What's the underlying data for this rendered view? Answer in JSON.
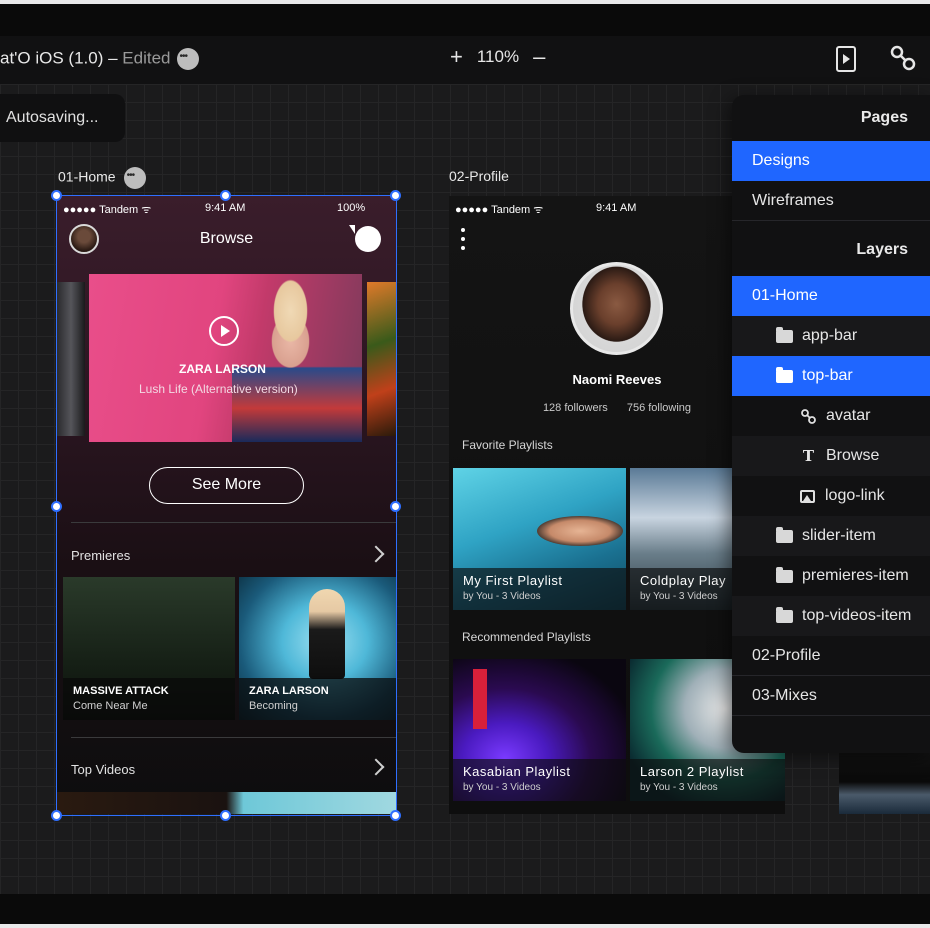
{
  "titlebar": {
    "doc_title": "at'O iOS (1.0) – ",
    "edited": "Edited",
    "zoom": "110%",
    "zoom_in": "+",
    "zoom_out": "–"
  },
  "autosave": "Autosaving...",
  "artboards": {
    "home_label": "01-Home",
    "profile_label": "02-Profile"
  },
  "home": {
    "status": {
      "carrier": "●●●●● Tandem ᯤ",
      "time": "9:41 AM",
      "battery": "100%"
    },
    "title": "Browse",
    "slide": {
      "artist": "ZARA LARSON",
      "song": "Lush Life (Alternative version)"
    },
    "see_more": "See More",
    "premieres_label": "Premieres",
    "tiles": [
      {
        "title": "MASSIVE ATTACK",
        "subtitle": "Come Near Me"
      },
      {
        "title": "ZARA LARSON",
        "subtitle": "Becoming"
      }
    ],
    "top_videos_label": "Top Videos"
  },
  "profile": {
    "status": {
      "carrier": "●●●●● Tandem ᯤ",
      "time": "9:41 AM"
    },
    "name": "Naomi Reeves",
    "followers": "128 followers",
    "following": "756 following",
    "favorite_label": "Favorite Playlists",
    "favorites": [
      {
        "title": "My First Playlist",
        "subtitle": "by You - 3 Videos"
      },
      {
        "title": "Coldplay Play",
        "subtitle": "by You - 3 Videos"
      }
    ],
    "recommended_label": "Recommended Playlists",
    "recommended": [
      {
        "title": "Kasabian Playlist",
        "subtitle": "by You - 3 Videos"
      },
      {
        "title": "Larson 2 Playlist",
        "subtitle": "by You - 3 Videos"
      }
    ]
  },
  "panel": {
    "pages_header": "Pages",
    "pages": [
      "Designs",
      "Wireframes"
    ],
    "layers_header": "Layers",
    "layers": [
      {
        "label": "01-Home",
        "icon": "none"
      },
      {
        "label": "app-bar",
        "icon": "folder-icon"
      },
      {
        "label": "top-bar",
        "icon": "folder-icon"
      },
      {
        "label": "avatar",
        "icon": "link-icon"
      },
      {
        "label": "Browse",
        "icon": "text-icon"
      },
      {
        "label": "logo-link",
        "icon": "image-icon"
      },
      {
        "label": "slider-item",
        "icon": "folder-icon"
      },
      {
        "label": "premieres-item",
        "icon": "folder-icon"
      },
      {
        "label": "top-videos-item",
        "icon": "folder-icon"
      },
      {
        "label": "02-Profile",
        "icon": "none"
      },
      {
        "label": "03-Mixes",
        "icon": "none"
      }
    ],
    "glyphs": {
      "text": "T"
    }
  },
  "colors": {
    "accent": "#1f66ff",
    "selection": "#2f6fff",
    "canvas": "#1b1b1c",
    "panel": "#111112"
  }
}
